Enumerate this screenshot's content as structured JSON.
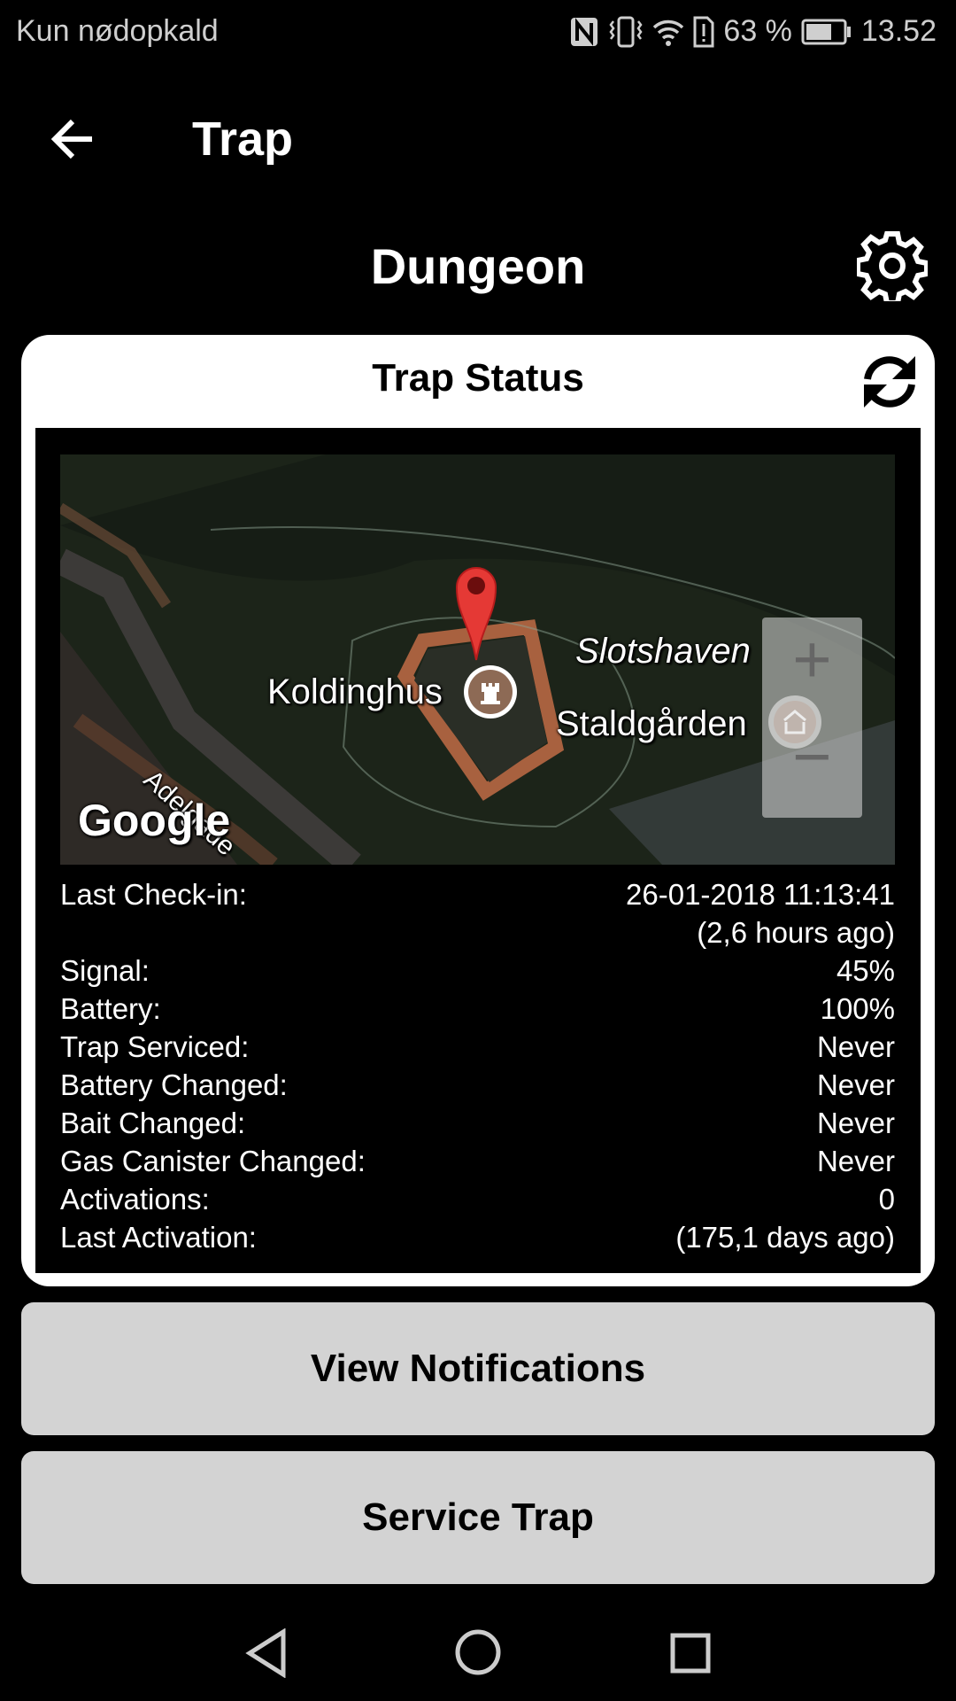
{
  "status_bar": {
    "carrier": "Kun nødopkald",
    "battery_percent": "63 %",
    "time": "13.52",
    "icons": [
      "nfc-icon",
      "vibrate-icon",
      "wifi-icon",
      "sim-alert-icon",
      "battery-icon"
    ]
  },
  "app_bar": {
    "title": "Trap",
    "back_icon": "arrow-left-icon"
  },
  "trap": {
    "name": "Dungeon",
    "settings_icon": "gear-icon"
  },
  "card": {
    "title": "Trap Status",
    "refresh_icon": "refresh-icon",
    "map": {
      "labels": {
        "castle": "Koldinghus",
        "park": "Slotshaven",
        "museum": "Staldgården",
        "street": "Adelgade"
      },
      "logo": "Google",
      "zoom_in": "+",
      "zoom_out": "−"
    },
    "rows": [
      {
        "label": "Last Check-in:",
        "value": "26-01-2018 11:13:41",
        "value2": "(2,6 hours ago)"
      },
      {
        "label": "Signal:",
        "value": "45%"
      },
      {
        "label": "Battery:",
        "value": "100%"
      },
      {
        "label": "Trap Serviced:",
        "value": "Never"
      },
      {
        "label": "Battery Changed:",
        "value": "Never"
      },
      {
        "label": "Bait Changed:",
        "value": "Never"
      },
      {
        "label": "Gas Canister Changed:",
        "value": "Never"
      },
      {
        "label": "Activations:",
        "value": "0"
      },
      {
        "label": "Last Activation:",
        "value": "(175,1 days ago)"
      }
    ]
  },
  "buttons": {
    "notifications": "View Notifications",
    "service": "Service Trap"
  },
  "nav": {
    "back": "triangle-back-icon",
    "home": "circle-home-icon",
    "recents": "square-recents-icon"
  }
}
